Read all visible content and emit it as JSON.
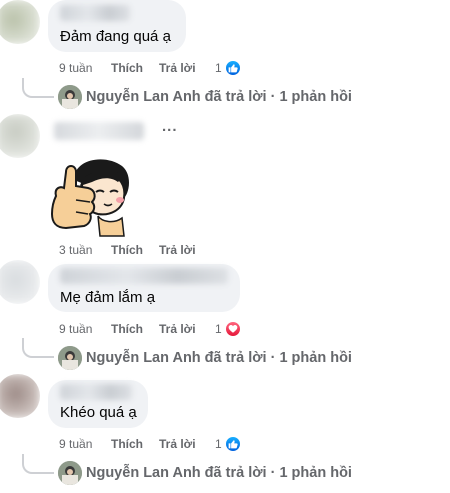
{
  "comments": [
    {
      "text": "Đảm đang quá ạ",
      "time": "9 tuần",
      "like": "Thích",
      "reply": "Trả lời",
      "reaction_count": "1",
      "reaction": "like",
      "reply_summary": "Nguyễn Lan Anh đã trả lời · 1 phản hồi"
    },
    {
      "more": "...",
      "sticker": "thumbs-up-girl-sticker",
      "time": "3 tuần",
      "like": "Thích",
      "reply": "Trả lời"
    },
    {
      "text": "Mẹ đảm lắm ạ",
      "time": "9 tuần",
      "like": "Thích",
      "reply": "Trả lời",
      "reaction_count": "1",
      "reaction": "love",
      "reply_summary": "Nguyễn Lan Anh đã trả lời · 1 phản hồi"
    },
    {
      "text": "Khéo quá ạ",
      "time": "9 tuần",
      "like": "Thích",
      "reply": "Trả lời",
      "reaction_count": "1",
      "reaction": "like",
      "reply_summary": "Nguyễn Lan Anh đã trả lời · 1 phản hồi"
    }
  ],
  "colors": {
    "bubble": "#f0f2f5",
    "meta_text": "#65676b",
    "like_blue": "#0866ff",
    "love_red": "#f33e58"
  }
}
